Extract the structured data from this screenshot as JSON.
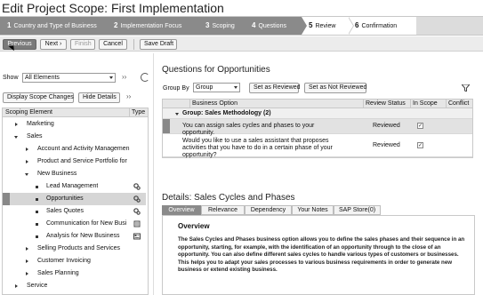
{
  "page": {
    "title": "Edit Project Scope: First Implementation"
  },
  "steps": [
    {
      "num": "1",
      "label": "Country and Type of Business"
    },
    {
      "num": "2",
      "label": "Implementation Focus"
    },
    {
      "num": "3",
      "label": "Scoping"
    },
    {
      "num": "4",
      "label": "Questions"
    },
    {
      "num": "5",
      "label": "Review"
    },
    {
      "num": "6",
      "label": "Confirmation"
    }
  ],
  "toolbar": {
    "previous": "Previous",
    "next": "Next",
    "next_chevrons": "›",
    "finish": "Finish",
    "cancel": "Cancel",
    "save_draft": "Save Draft"
  },
  "left": {
    "show_label": "Show",
    "show_value": "All Elements",
    "expand_chevrons": "››",
    "display_scope_changes": "Display Scope Changes",
    "hide_details": "Hide Details",
    "columns": {
      "element": "Scoping Element",
      "type": "Type"
    },
    "tree": [
      {
        "label": "Marketing"
      },
      {
        "label": "Sales"
      },
      {
        "label": "Account and Activity Managemen"
      },
      {
        "label": "Product and Service Portfolio for"
      },
      {
        "label": "New Business"
      },
      {
        "label": "Lead Management"
      },
      {
        "label": "Opportunities"
      },
      {
        "label": "Sales Quotes"
      },
      {
        "label": "Communication for New Busi"
      },
      {
        "label": "Analysis for New Business"
      },
      {
        "label": "Selling Products and Services"
      },
      {
        "label": "Customer Invoicing"
      },
      {
        "label": "Sales Planning"
      },
      {
        "label": "Service"
      }
    ]
  },
  "questions": {
    "title": "Questions for Opportunities",
    "group_by_label": "Group By",
    "group_by_value": "Group",
    "set_reviewed": "Set as Reviewed",
    "set_not_reviewed": "Set as Not Reviewed",
    "columns": {
      "option": "Business Option",
      "status": "Review Status",
      "in_scope": "In Scope",
      "conflict": "Conflict"
    },
    "group_label": "Group: Sales Methodology (2)",
    "rows": [
      {
        "option": "You can assign sales cycles and phases to your opportunity.",
        "status": "Reviewed",
        "in_scope": "✓"
      },
      {
        "option": "Would you like to use a sales assistant that proposes activities that you have to do in a certain phase of your opportunity?",
        "status": "Reviewed",
        "in_scope": "✓"
      }
    ]
  },
  "details": {
    "title": "Details: Sales Cycles and Phases",
    "tabs": [
      "Overview",
      "Relevance",
      "Dependency",
      "Your Notes",
      "SAP Store(0)"
    ],
    "overview_title": "Overview",
    "overview_text": "The Sales Cycles and Phases business option allows you to define the sales phases and their sequence in an opportunity, starting, for example, with the identification of an opportunity through to the close of an opportunity. You can also define different sales cycles to handle various types of customers or businesses. This helps you to adapt your sales processes to various business requirements in order to generate new business or extend existing business."
  },
  "colors": {
    "accent_grey": "#8a8a8a",
    "header_grey": "#e6e6e6",
    "selected_row": "#d6d6d6"
  }
}
